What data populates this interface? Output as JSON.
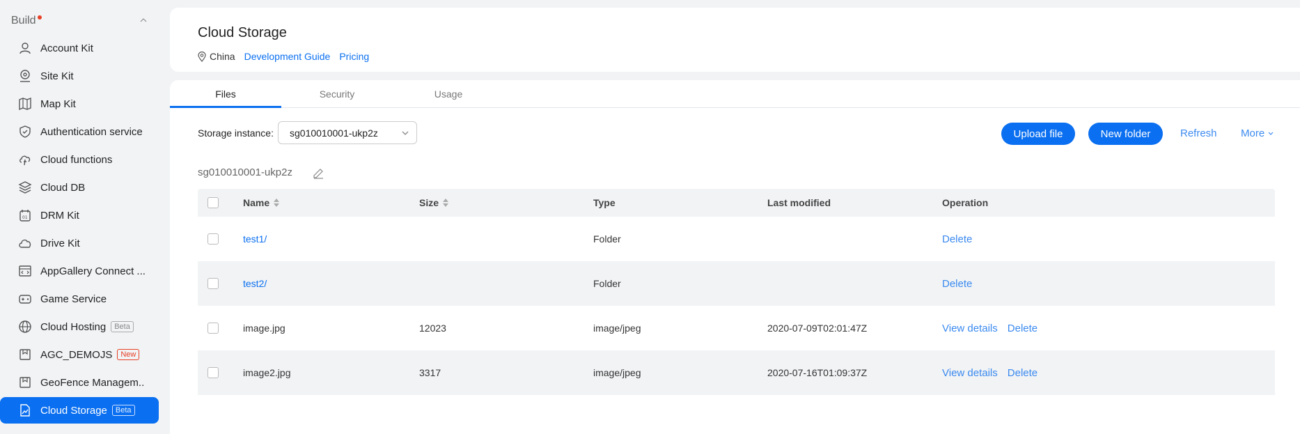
{
  "sidebar": {
    "group_title": "Build",
    "items": [
      {
        "label": "Account Kit",
        "icon": "user-icon"
      },
      {
        "label": "Site Kit",
        "icon": "location-pin-icon"
      },
      {
        "label": "Map Kit",
        "icon": "map-icon"
      },
      {
        "label": "Authentication service",
        "icon": "shield-check-icon"
      },
      {
        "label": "Cloud functions",
        "icon": "cloud-function-icon"
      },
      {
        "label": "Cloud DB",
        "icon": "database-layers-icon"
      },
      {
        "label": "DRM Kit",
        "icon": "drm-icon"
      },
      {
        "label": "Drive Kit",
        "icon": "cloud-icon"
      },
      {
        "label": "AppGallery Connect ...",
        "icon": "code-window-icon"
      },
      {
        "label": "Game Service",
        "icon": "gamepad-icon"
      },
      {
        "label": "Cloud Hosting",
        "icon": "globe-icon",
        "badge": "Beta"
      },
      {
        "label": "AGC_DEMOJS",
        "icon": "bookmark-box-icon",
        "badge": "New"
      },
      {
        "label": "GeoFence Managem...",
        "icon": "bookmark-box-icon"
      },
      {
        "label": "Cloud Storage",
        "icon": "image-file-icon",
        "badge": "Beta"
      }
    ]
  },
  "header": {
    "title": "Cloud Storage",
    "region": "China",
    "links": [
      "Development Guide",
      "Pricing"
    ]
  },
  "tabs": [
    "Files",
    "Security",
    "Usage"
  ],
  "toolbar": {
    "instance_label": "Storage instance:",
    "instance_value": "sg010010001-ukp2z",
    "upload": "Upload file",
    "new_folder": "New folder",
    "refresh": "Refresh",
    "more": "More"
  },
  "instance_name": "sg010010001-ukp2z",
  "table": {
    "columns": [
      "Name",
      "Size",
      "Type",
      "Last modified",
      "Operation"
    ],
    "rows": [
      {
        "name": "test1/",
        "size": "",
        "type": "Folder",
        "modified": "",
        "ops": [
          "Delete"
        ]
      },
      {
        "name": "test2/",
        "size": "",
        "type": "Folder",
        "modified": "",
        "ops": [
          "Delete"
        ]
      },
      {
        "name": "image.jpg",
        "size": "12023",
        "type": "image/jpeg",
        "modified": "2020-07-09T02:01:47Z",
        "ops": [
          "View details",
          "Delete"
        ]
      },
      {
        "name": "image2.jpg",
        "size": "3317",
        "type": "image/jpeg",
        "modified": "2020-07-16T01:09:37Z",
        "ops": [
          "View details",
          "Delete"
        ]
      }
    ]
  },
  "colors": {
    "accent": "#0a6ff0",
    "link": "#3b8aef",
    "new_badge": "#e84026"
  }
}
